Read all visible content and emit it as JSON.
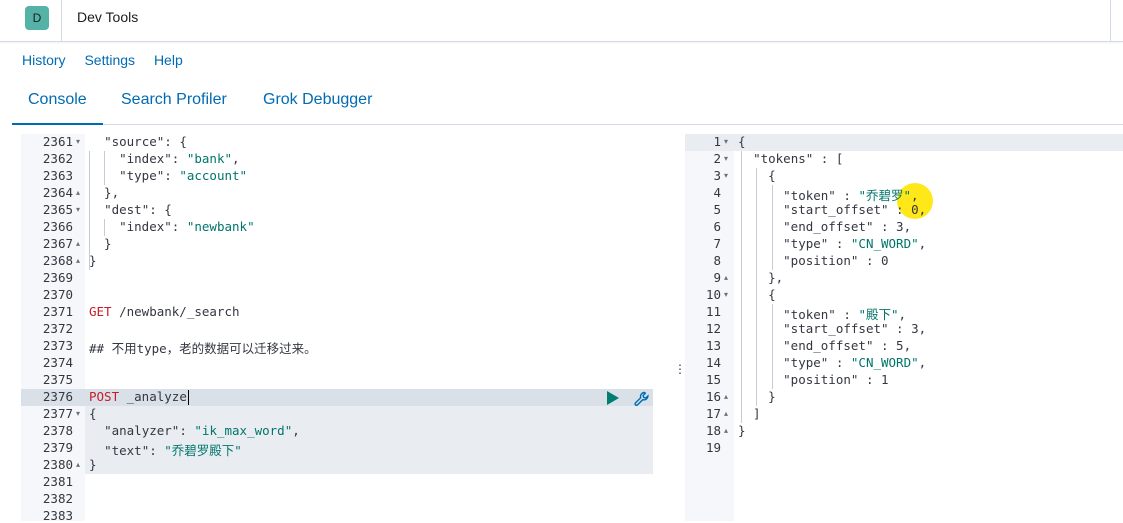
{
  "header": {
    "avatar_letter": "D",
    "app_title": "Dev Tools"
  },
  "menu": [
    "History",
    "Settings",
    "Help"
  ],
  "tabs": [
    "Console",
    "Search Profiler",
    "Grok Debugger"
  ],
  "request_editor": {
    "lines": [
      {
        "no": "2361",
        "fold": "▾",
        "text": "  \"source\": {"
      },
      {
        "no": "2362",
        "fold": "",
        "text": "    \"index\": \"bank\","
      },
      {
        "no": "2363",
        "fold": "",
        "text": "    \"type\": \"account\""
      },
      {
        "no": "2364",
        "fold": "▴",
        "text": "  },"
      },
      {
        "no": "2365",
        "fold": "▾",
        "text": "  \"dest\": {"
      },
      {
        "no": "2366",
        "fold": "",
        "text": "    \"index\": \"newbank\""
      },
      {
        "no": "2367",
        "fold": "▴",
        "text": "  }"
      },
      {
        "no": "2368",
        "fold": "▴",
        "text": "}"
      },
      {
        "no": "2369",
        "fold": "",
        "text": ""
      },
      {
        "no": "2370",
        "fold": "",
        "text": ""
      },
      {
        "no": "2371",
        "fold": "",
        "text": "GET /newbank/_search"
      },
      {
        "no": "2372",
        "fold": "",
        "text": ""
      },
      {
        "no": "2373",
        "fold": "",
        "text": "## 不用type，老的数据可以迁移过来。"
      },
      {
        "no": "2374",
        "fold": "",
        "text": ""
      },
      {
        "no": "2375",
        "fold": "",
        "text": ""
      },
      {
        "no": "2376",
        "fold": "",
        "text": "POST _analyze"
      },
      {
        "no": "2377",
        "fold": "▾",
        "text": "{"
      },
      {
        "no": "2378",
        "fold": "",
        "text": "  \"analyzer\": \"ik_max_word\","
      },
      {
        "no": "2379",
        "fold": "",
        "text": "  \"text\": \"乔碧罗殿下\""
      },
      {
        "no": "2380",
        "fold": "▴",
        "text": "}"
      },
      {
        "no": "2381",
        "fold": "",
        "text": ""
      },
      {
        "no": "2382",
        "fold": "",
        "text": ""
      },
      {
        "no": "2383",
        "fold": "",
        "text": ""
      }
    ]
  },
  "response_editor": {
    "lines": [
      {
        "no": "1",
        "fold": "▾",
        "text": "{"
      },
      {
        "no": "2",
        "fold": "▾",
        "text": "  \"tokens\" : ["
      },
      {
        "no": "3",
        "fold": "▾",
        "text": "    {"
      },
      {
        "no": "4",
        "fold": "",
        "text": "      \"token\" : \"乔碧罗\","
      },
      {
        "no": "5",
        "fold": "",
        "text": "      \"start_offset\" : 0,"
      },
      {
        "no": "6",
        "fold": "",
        "text": "      \"end_offset\" : 3,"
      },
      {
        "no": "7",
        "fold": "",
        "text": "      \"type\" : \"CN_WORD\","
      },
      {
        "no": "8",
        "fold": "",
        "text": "      \"position\" : 0"
      },
      {
        "no": "9",
        "fold": "▴",
        "text": "    },"
      },
      {
        "no": "10",
        "fold": "▾",
        "text": "    {"
      },
      {
        "no": "11",
        "fold": "",
        "text": "      \"token\" : \"殿下\","
      },
      {
        "no": "12",
        "fold": "",
        "text": "      \"start_offset\" : 3,"
      },
      {
        "no": "13",
        "fold": "",
        "text": "      \"end_offset\" : 5,"
      },
      {
        "no": "14",
        "fold": "",
        "text": "      \"type\" : \"CN_WORD\","
      },
      {
        "no": "15",
        "fold": "",
        "text": "      \"position\" : 1"
      },
      {
        "no": "16",
        "fold": "▴",
        "text": "    }"
      },
      {
        "no": "17",
        "fold": "▴",
        "text": "  ]"
      },
      {
        "no": "18",
        "fold": "▴",
        "text": "}"
      },
      {
        "no": "19",
        "fold": "",
        "text": ""
      }
    ]
  },
  "icons": {
    "play": "play-icon",
    "wrench": "wrench-icon",
    "resizer": "vertical-dots-icon"
  },
  "colors": {
    "accent": "#006bb4",
    "play": "#017d73",
    "method": "#c61e25",
    "string": "#00756b"
  }
}
